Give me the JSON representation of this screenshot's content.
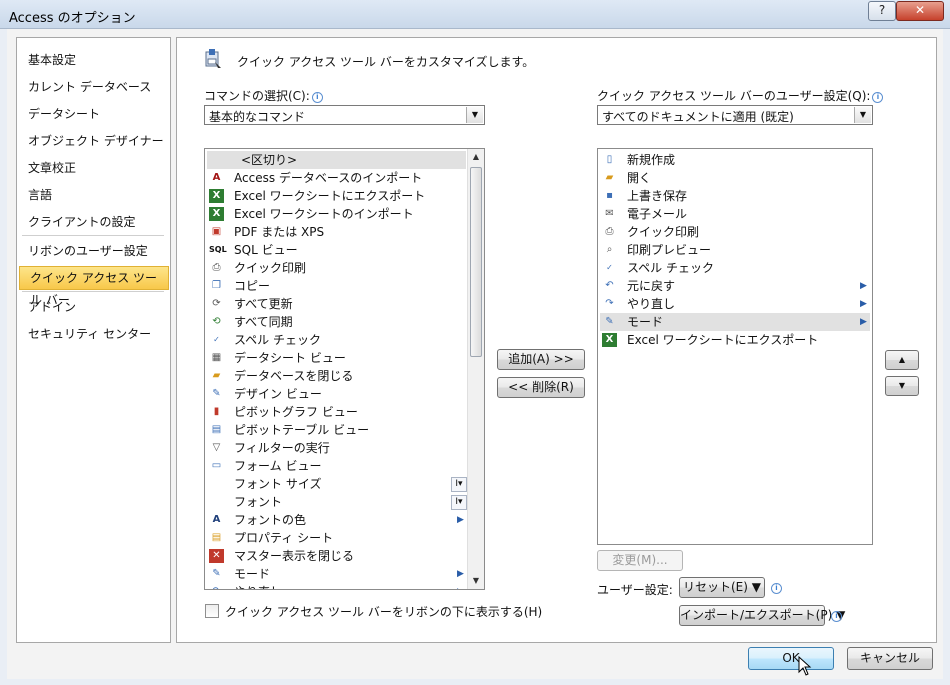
{
  "window": {
    "title": "Access のオプション",
    "help_label": "?",
    "close_label": "✕"
  },
  "nav": {
    "items": [
      {
        "label": "基本設定"
      },
      {
        "label": "カレント データベース"
      },
      {
        "label": "データシート"
      },
      {
        "label": "オブジェクト デザイナー"
      },
      {
        "label": "文章校正"
      },
      {
        "label": "言語"
      },
      {
        "label": "クライアントの設定"
      },
      {
        "label": "リボンのユーザー設定"
      },
      {
        "label": "クイック アクセス ツール バー",
        "selected": true
      },
      {
        "label": "アドイン"
      },
      {
        "label": "セキュリティ センター"
      }
    ]
  },
  "header": {
    "title": "クイック アクセス ツール バーをカスタマイズします。"
  },
  "commands": {
    "label": "コマンドの選択(C):",
    "selected": "基本的なコマンド",
    "items": [
      {
        "label": "<区切り>",
        "icon": "separator",
        "selected": true
      },
      {
        "label": "Access データベースのインポート",
        "icon": "access-import-icon"
      },
      {
        "label": "Excel ワークシートにエクスポート",
        "icon": "excel-export-icon"
      },
      {
        "label": "Excel ワークシートのインポート",
        "icon": "excel-import-icon"
      },
      {
        "label": "PDF または XPS",
        "icon": "pdf-icon"
      },
      {
        "label": "SQL ビュー",
        "icon": "sql-icon"
      },
      {
        "label": "クイック印刷",
        "icon": "printer-icon"
      },
      {
        "label": "コピー",
        "icon": "copy-icon"
      },
      {
        "label": "すべて更新",
        "icon": "refresh-all-icon"
      },
      {
        "label": "すべて同期",
        "icon": "sync-all-icon"
      },
      {
        "label": "スペル チェック",
        "icon": "spell-check-icon"
      },
      {
        "label": "データシート ビュー",
        "icon": "datasheet-icon"
      },
      {
        "label": "データベースを閉じる",
        "icon": "close-db-icon"
      },
      {
        "label": "デザイン ビュー",
        "icon": "design-view-icon"
      },
      {
        "label": "ピボットグラフ ビュー",
        "icon": "pivot-chart-icon"
      },
      {
        "label": "ピボットテーブル ビュー",
        "icon": "pivot-table-icon"
      },
      {
        "label": "フィルターの実行",
        "icon": "filter-icon"
      },
      {
        "label": "フォーム ビュー",
        "icon": "form-view-icon"
      },
      {
        "label": "フォント サイズ",
        "icon": "none",
        "font_dd": true
      },
      {
        "label": "フォント",
        "icon": "none",
        "font_dd": true
      },
      {
        "label": "フォントの色",
        "icon": "font-color-icon",
        "submenu": true
      },
      {
        "label": "プロパティ シート",
        "icon": "property-sheet-icon"
      },
      {
        "label": "マスター表示を閉じる",
        "icon": "close-master-icon"
      },
      {
        "label": "モード",
        "icon": "mode-icon",
        "submenu": true
      },
      {
        "label": "やり直し",
        "icon": "redo-icon",
        "submenu": true
      }
    ]
  },
  "qat": {
    "label": "クイック アクセス ツール バーのユーザー設定(Q):",
    "selected": "すべてのドキュメントに適用 (既定)",
    "items": [
      {
        "label": "新規作成",
        "icon": "new-doc-icon"
      },
      {
        "label": "開く",
        "icon": "open-folder-icon"
      },
      {
        "label": "上書き保存",
        "icon": "save-icon"
      },
      {
        "label": "電子メール",
        "icon": "email-icon"
      },
      {
        "label": "クイック印刷",
        "icon": "printer-icon"
      },
      {
        "label": "印刷プレビュー",
        "icon": "print-preview-icon"
      },
      {
        "label": "スペル チェック",
        "icon": "spell-check-icon"
      },
      {
        "label": "元に戻す",
        "icon": "undo-icon",
        "submenu": true
      },
      {
        "label": "やり直し",
        "icon": "redo-icon",
        "submenu": true
      },
      {
        "label": "モード",
        "icon": "mode-icon",
        "submenu": true,
        "selected": true
      },
      {
        "label": "Excel ワークシートにエクスポート",
        "icon": "excel-export-icon"
      }
    ]
  },
  "buttons": {
    "add": "追加(A) >>",
    "remove": "<< 削除(R)",
    "move_up": "▲",
    "move_down": "▼",
    "modify": "変更(M)...",
    "reset": "リセット(E) ▼",
    "import_export": "インポート/エクスポート(P) ▼",
    "ok": "OK",
    "cancel": "キャンセル"
  },
  "user_settings_label": "ユーザー設定:",
  "show_below_ribbon": {
    "label": "クイック アクセス ツール バーをリボンの下に表示する(H)",
    "checked": false
  },
  "info_glyph": "i",
  "dropdown_glyph": "▼",
  "scroll_up_glyph": "▲",
  "scroll_down_glyph": "▼",
  "submenu_glyph": "▶",
  "font_dd_glyph": "I▾",
  "colors": {
    "selection_gold": "#f8c84a",
    "frame_blue": "#c9d8ea",
    "accent_blue": "#3c7fd1"
  }
}
